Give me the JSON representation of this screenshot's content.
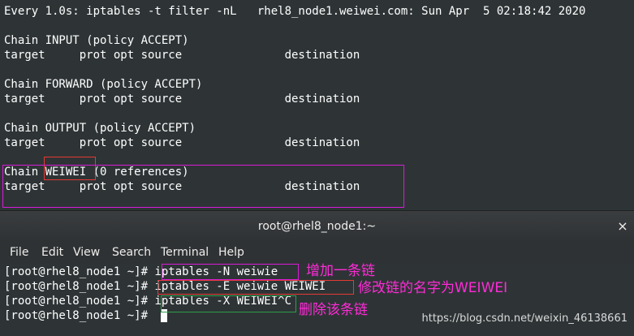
{
  "watch_output": {
    "header": "Every 1.0s: iptables -t filter -nL   rhel8_node1.weiwei.com: Sun Apr  5 02:18:42 2020",
    "columns_line": "target     prot opt source               destination",
    "chains": [
      {
        "title_prefix": "Chain INPUT (policy ACCEPT)"
      },
      {
        "title_prefix": "Chain FORWARD (policy ACCEPT)"
      },
      {
        "title_prefix": "Chain OUTPUT (policy ACCEPT)"
      },
      {
        "chain_word": "Chain ",
        "chain_name": "WEIWEI",
        "chain_suffix": " (0 references)"
      }
    ]
  },
  "window": {
    "title": "root@rhel8_node1:~",
    "close_glyph": "×"
  },
  "menu": [
    "File",
    "Edit",
    "View",
    "Search",
    "Terminal",
    "Help"
  ],
  "shell": {
    "prompt": "[root@rhel8_node1 ~]# ",
    "commands": [
      "iptables -N weiwie",
      "iptables -E weiwie WEIWEI",
      "iptables -X WEIWEI^C",
      ""
    ]
  },
  "annotations": {
    "add_chain": "增加一条链",
    "rename_chain": "修改链的名字为WEIWEI",
    "delete_chain": "删除该条链"
  },
  "watermark": "https://blog.csdn.net/weixin_46138661",
  "colors": {
    "terminal_bg": "#2e3436",
    "text": "#ffffff",
    "annotation_magenta": "#ff2bd8",
    "red_box": "#e53935",
    "green_box": "#2e9e4a"
  }
}
